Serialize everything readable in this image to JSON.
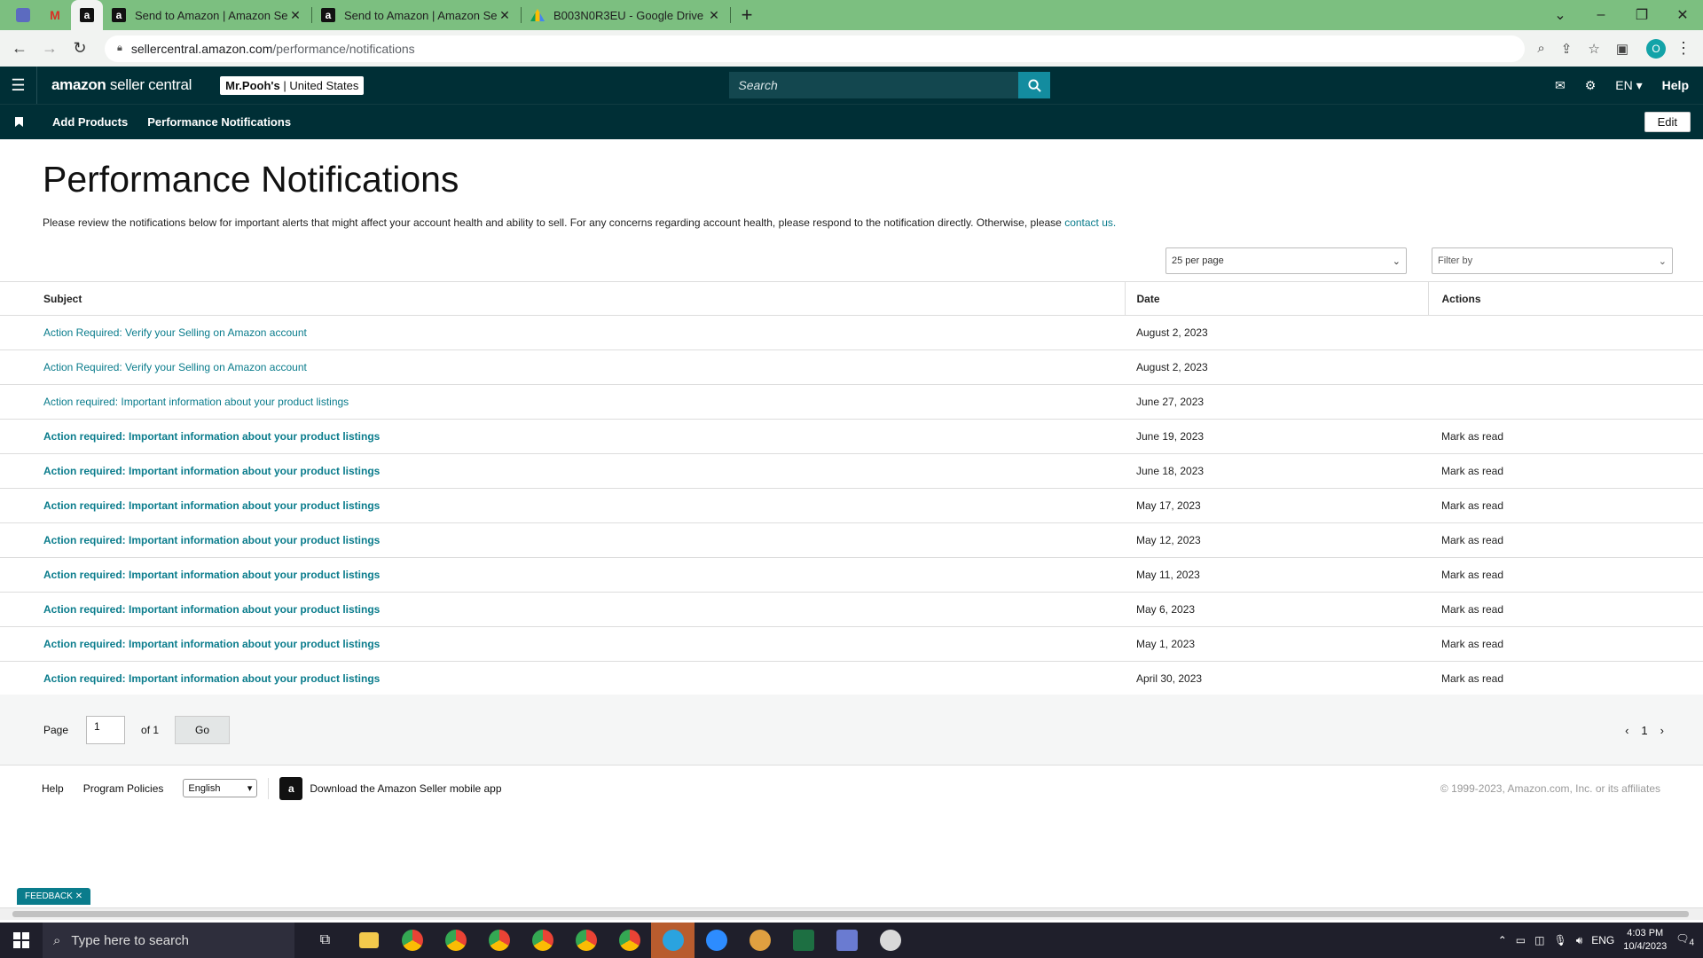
{
  "browser": {
    "tabs": [
      {
        "title": "Send to Amazon | Amazon Seller Central"
      },
      {
        "title": "Send to Amazon | Amazon Seller Central"
      },
      {
        "title": "B003N0R3EU - Google Drive"
      }
    ],
    "url_host": "sellercentral.amazon.com",
    "url_path": "/performance/notifications",
    "profile_initial": "O"
  },
  "header": {
    "logo_main": "amazon",
    "logo_sub": " seller central",
    "store_name": "Mr.Pooh's",
    "store_region": "United States",
    "search_placeholder": "Search",
    "lang": "EN",
    "help": "Help"
  },
  "subnav": {
    "items": [
      "Add Products",
      "Performance Notifications"
    ],
    "edit": "Edit"
  },
  "page": {
    "title": "Performance Notifications",
    "intro": "Please review the notifications below for important alerts that might affect your account health and ability to sell. For any concerns regarding account health, please respond to the notification directly. Otherwise, please ",
    "intro_link": "contact us.",
    "per_page": "25 per page",
    "filter": "Filter by"
  },
  "table": {
    "headers": [
      "Subject",
      "Date",
      "Actions"
    ],
    "rows": [
      {
        "subject": "Action Required: Verify your Selling on Amazon account",
        "date": "August 2, 2023",
        "action": "",
        "unread": false
      },
      {
        "subject": "Action Required: Verify your Selling on Amazon account",
        "date": "August 2, 2023",
        "action": "",
        "unread": false
      },
      {
        "subject": "Action required: Important information about your product listings",
        "date": "June 27, 2023",
        "action": "",
        "unread": false
      },
      {
        "subject": "Action required: Important information about your product listings",
        "date": "June 19, 2023",
        "action": "Mark as read",
        "unread": true
      },
      {
        "subject": "Action required: Important information about your product listings",
        "date": "June 18, 2023",
        "action": "Mark as read",
        "unread": true
      },
      {
        "subject": "Action required: Important information about your product listings",
        "date": "May 17, 2023",
        "action": "Mark as read",
        "unread": true
      },
      {
        "subject": "Action required: Important information about your product listings",
        "date": "May 12, 2023",
        "action": "Mark as read",
        "unread": true
      },
      {
        "subject": "Action required: Important information about your product listings",
        "date": "May 11, 2023",
        "action": "Mark as read",
        "unread": true
      },
      {
        "subject": "Action required: Important information about your product listings",
        "date": "May 6, 2023",
        "action": "Mark as read",
        "unread": true
      },
      {
        "subject": "Action required: Important information about your product listings",
        "date": "May 1, 2023",
        "action": "Mark as read",
        "unread": true
      },
      {
        "subject": "Action required: Important information about your product listings",
        "date": "April 30, 2023",
        "action": "Mark as read",
        "unread": true
      }
    ]
  },
  "pager": {
    "label": "Page",
    "value": "1",
    "of": "of 1",
    "go": "Go",
    "current": "1"
  },
  "footer": {
    "help": "Help",
    "policies": "Program Policies",
    "language": "English",
    "download": "Download the Amazon Seller mobile app",
    "copyright": "© 1999-2023, Amazon.com, Inc. or its affiliates"
  },
  "feedback": "FEEDBACK",
  "taskbar": {
    "search_placeholder": "Type here to search",
    "lang": "ENG",
    "time": "4:03 PM",
    "date": "10/4/2023",
    "notif_count": "4"
  },
  "colors": {
    "header_bg": "#002f36",
    "link": "#0a7c8c",
    "tabbar": "#7cbf80"
  }
}
